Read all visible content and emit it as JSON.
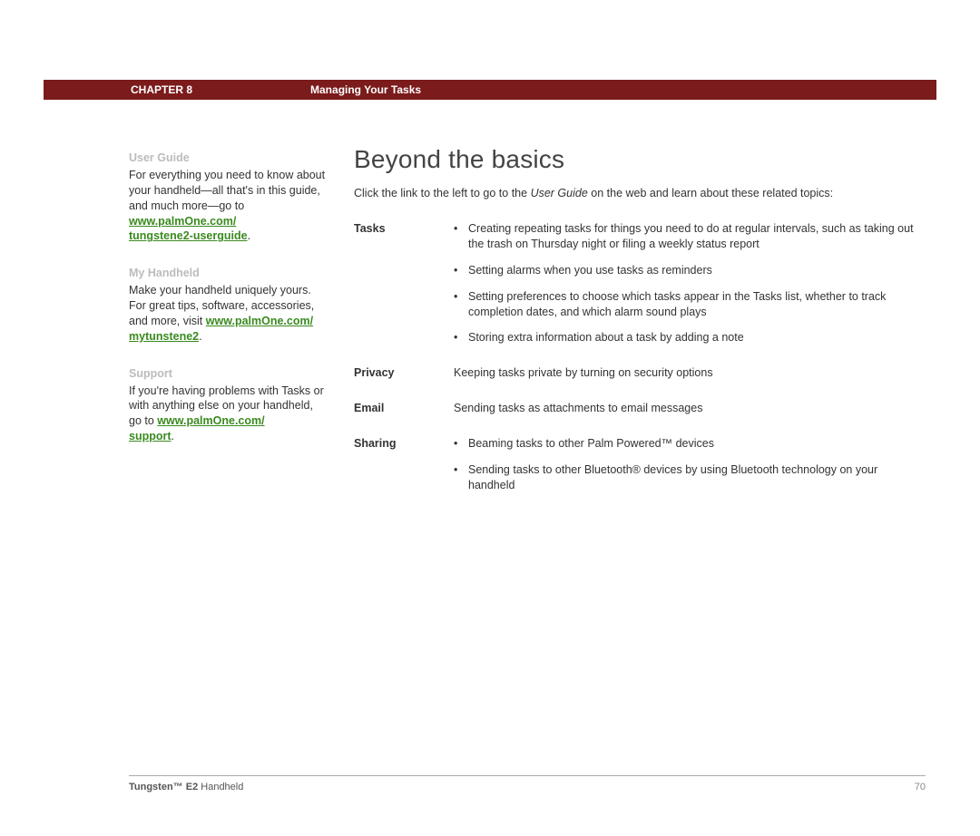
{
  "header": {
    "chapter": "CHAPTER 8",
    "title": "Managing Your Tasks"
  },
  "sidebar": {
    "userGuide": {
      "heading": "User Guide",
      "text": "For everything you need to know about your handheld—all that's in this guide, and much more—go to ",
      "linkA": "www.palmOne.com/",
      "linkB": "tungstene2-userguide",
      "after": "."
    },
    "myHandheld": {
      "heading": "My Handheld",
      "text": "Make your handheld uniquely yours. For great tips, software, accessories, and more, visit ",
      "linkA": "www.palmOne.com/",
      "linkB": "mytunstene2",
      "after": "."
    },
    "support": {
      "heading": "Support",
      "text": "If you're having problems with Tasks or with anything else on your handheld, go to ",
      "linkA": "www.palmOne.com/",
      "linkB": "support",
      "after": "."
    }
  },
  "main": {
    "title": "Beyond the basics",
    "introPrefix": "Click the link to the left to go to the ",
    "introEm": "User Guide",
    "introSuffix": " on the web and learn about these related topics:",
    "topics": {
      "tasks": {
        "label": "Tasks",
        "b1": "Creating repeating tasks for things you need to do at regular intervals, such as taking out the trash on Thursday night or filing a weekly status report",
        "b2": "Setting alarms when you use tasks as reminders",
        "b3": "Setting preferences to choose which tasks appear in the Tasks list, whether to track completion dates, and which alarm sound plays",
        "b4": "Storing extra information about a task by adding a note"
      },
      "privacy": {
        "label": "Privacy",
        "text": "Keeping tasks private by turning on security options"
      },
      "email": {
        "label": "Email",
        "text": "Sending tasks as attachments to email messages"
      },
      "sharing": {
        "label": "Sharing",
        "b1": "Beaming tasks to other Palm Powered™ devices",
        "b2": "Sending tasks to other Bluetooth® devices by using Bluetooth technology on your handheld"
      }
    }
  },
  "footer": {
    "productBold": "Tungsten™ E2",
    "productRest": " Handheld",
    "page": "70"
  }
}
